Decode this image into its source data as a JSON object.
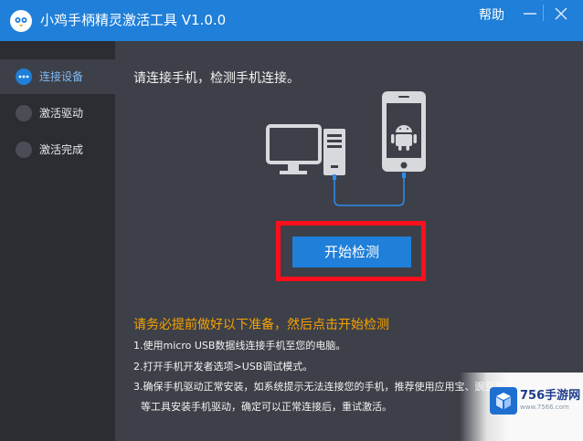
{
  "window": {
    "title": "小鸡手柄精灵激活工具 V1.0.0",
    "help_label": "帮助",
    "logo_icon": "chick-logo-icon",
    "minimize_icon": "minimize-icon",
    "close_icon": "close-icon"
  },
  "sidebar": {
    "items": [
      {
        "label": "连接设备",
        "active": true,
        "icon": "dots-icon"
      },
      {
        "label": "激活驱动",
        "active": false,
        "icon": "circle-icon"
      },
      {
        "label": "激活完成",
        "active": false,
        "icon": "circle-icon"
      }
    ]
  },
  "main": {
    "instruction": "请连接手机，检测手机连接。",
    "illustration_icons": [
      "computer-icon",
      "android-phone-icon",
      "usb-cable-icon"
    ],
    "start_button": "开始检测",
    "prereq_title": "请务必提前做好以下准备，然后点击开始检测",
    "steps": [
      "1.使用micro USB数据线连接手机至您的电脑。",
      "2.打开手机开发者选项>USB调试模式。",
      "3.确保手机驱动正常安装，如系统提示无法连接您的手机，推荐使用应用宝、豌豆荚",
      "等工具安装手机驱动，确定可以正常连接后，重试激活。"
    ]
  },
  "watermark": {
    "brand": "756手游网",
    "url": "www.7566.com"
  },
  "colors": {
    "titlebar": "#1f7fd9",
    "sidebar": "#2b2d33",
    "main_bg": "#3d4048",
    "accent": "#1f7fd9",
    "highlight": "#ff0f1c",
    "prereq": "#f7a200"
  }
}
